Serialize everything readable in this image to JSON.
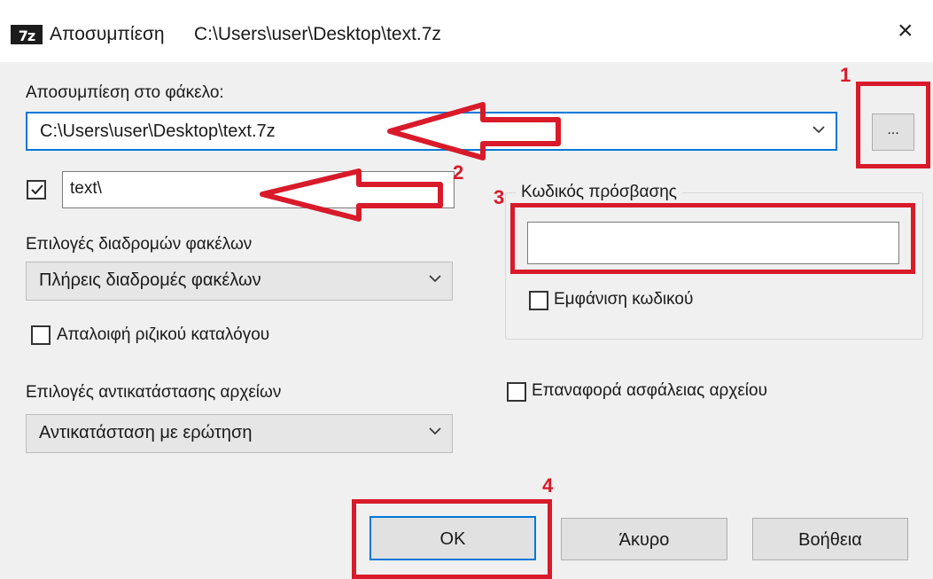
{
  "window": {
    "logo_text": "7z",
    "title": "Αποσυμπίεση",
    "title_path": "C:\\Users\\user\\Desktop\\text.7z",
    "close_glyph": "×"
  },
  "extract_to": {
    "label": "Αποσυμπίεση στο φάκελο:",
    "value": "C:\\Users\\user\\Desktop\\text.7z",
    "browse_label": "..."
  },
  "subfolder": {
    "checked": true,
    "value": "text\\"
  },
  "path_options": {
    "label": "Επιλογές διαδρομών φακέλων",
    "selected": "Πλήρεις διαδρομές φακέλων"
  },
  "eliminate_root": {
    "label": "Απαλοιφή ριζικού καταλόγου",
    "checked": false
  },
  "overwrite_options": {
    "label": "Επιλογές αντικατάστασης αρχείων",
    "selected": "Αντικατάσταση με ερώτηση"
  },
  "password": {
    "group_label": "Κωδικός πρόσβασης",
    "value": "",
    "show_label": "Εμφάνιση κωδικού",
    "show_checked": false
  },
  "restore_security": {
    "label": "Επαναφορά ασφάλειας αρχείου",
    "checked": false
  },
  "buttons": {
    "ok": "OK",
    "cancel": "Άκυρο",
    "help": "Βοήθεια"
  },
  "annotations": {
    "color": "#d81a2a",
    "numbers": [
      "1",
      "2",
      "3",
      "4"
    ]
  }
}
